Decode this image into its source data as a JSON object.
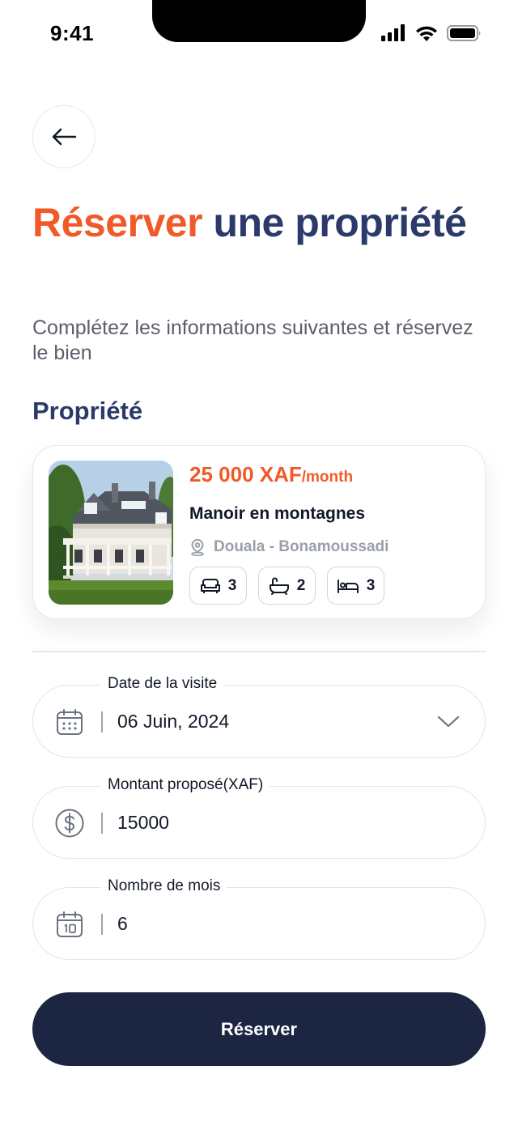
{
  "status_bar": {
    "time": "9:41"
  },
  "header": {
    "title_accent": "Réserver",
    "title_rest": " une propriété",
    "subtitle": "Complétez les informations suivantes et réservez le bien"
  },
  "property_section": {
    "title": "Propriété",
    "card": {
      "price": "25 000 XAF",
      "price_unit": "/month",
      "name": "Manoir en montagnes",
      "location": "Douala - Bonamoussadi",
      "amenities": [
        {
          "icon": "sofa-icon",
          "count": "3"
        },
        {
          "icon": "bathtub-icon",
          "count": "2"
        },
        {
          "icon": "bed-icon",
          "count": "3"
        }
      ]
    }
  },
  "form": {
    "visit_date": {
      "label": "Date de la visite",
      "value": "06 Juin, 2024",
      "icon": "calendar-icon"
    },
    "amount": {
      "label": "Montant proposé(XAF)",
      "value": "15000",
      "icon": "dollar-circle-icon"
    },
    "months": {
      "label": "Nombre de mois",
      "value": "6",
      "icon": "calendar-date-icon"
    }
  },
  "reserve_button": {
    "label": "Réserver"
  },
  "colors": {
    "accent": "#f05a28",
    "title_navy": "#2b3a6b",
    "button_dark": "#1c2542"
  }
}
